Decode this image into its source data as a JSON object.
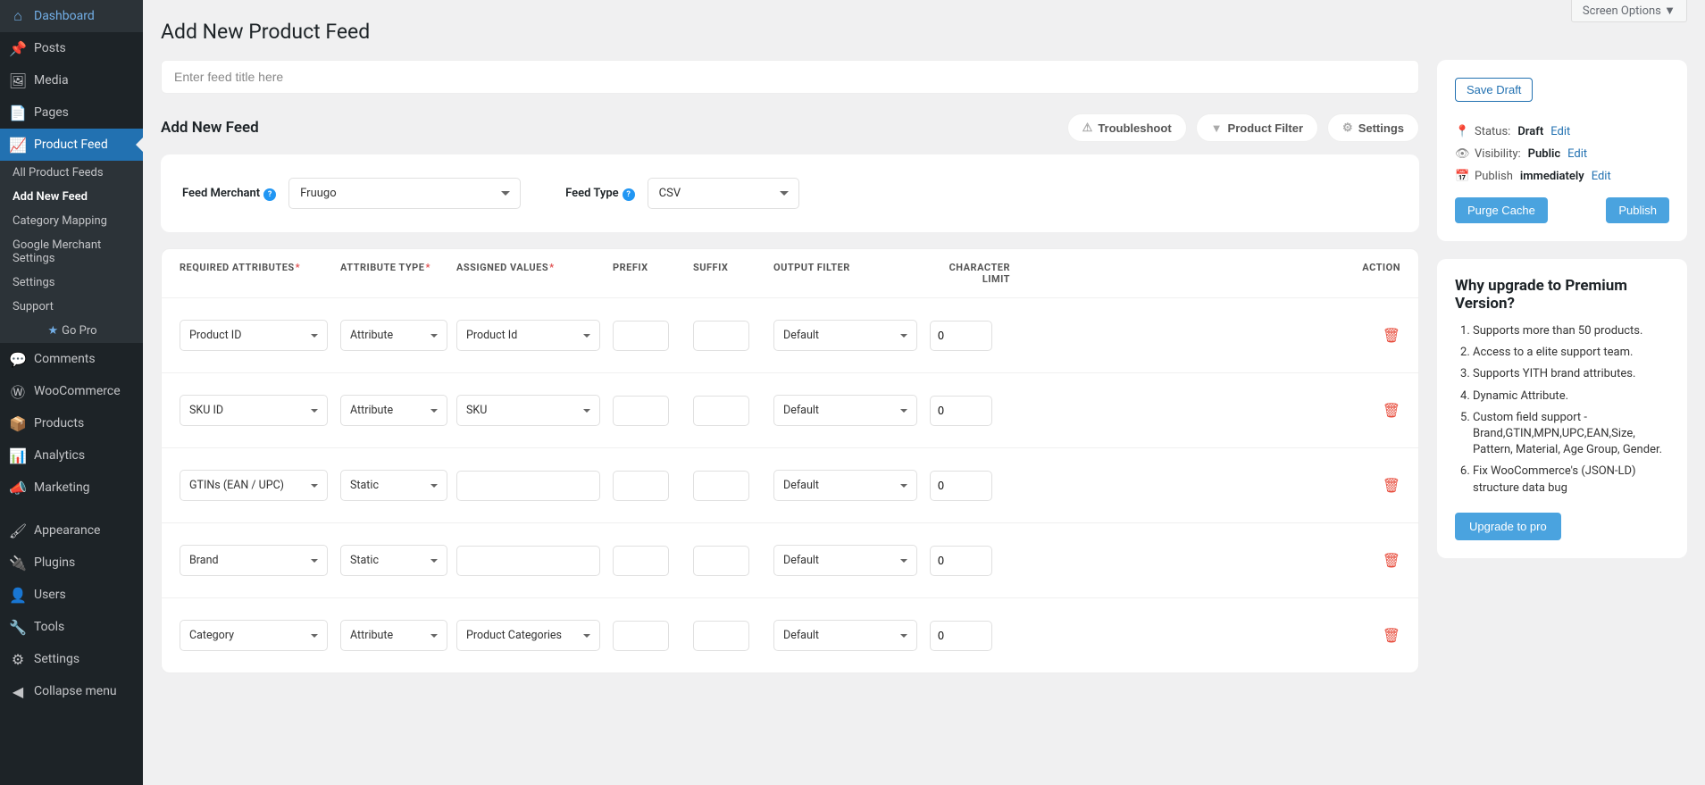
{
  "screen_options": "Screen Options",
  "sidebar": {
    "dashboard": "Dashboard",
    "posts": "Posts",
    "media": "Media",
    "pages": "Pages",
    "product_feed": "Product Feed",
    "sub": {
      "all_feeds": "All Product Feeds",
      "add_new": "Add New Feed",
      "category_mapping": "Category Mapping",
      "google_merchant": "Google Merchant Settings",
      "settings": "Settings",
      "support": "Support",
      "go_pro": "Go Pro"
    },
    "comments": "Comments",
    "woocommerce": "WooCommerce",
    "products": "Products",
    "analytics": "Analytics",
    "marketing": "Marketing",
    "appearance": "Appearance",
    "plugins": "Plugins",
    "users": "Users",
    "tools": "Tools",
    "settings": "Settings",
    "collapse": "Collapse menu"
  },
  "page_title": "Add New Product Feed",
  "title_placeholder": "Enter feed title here",
  "section_title": "Add New Feed",
  "buttons": {
    "troubleshoot": "Troubleshoot",
    "product_filter": "Product Filter",
    "settings": "Settings"
  },
  "merchant": {
    "feed_merchant_label": "Feed Merchant",
    "feed_merchant_value": "Fruugo",
    "feed_type_label": "Feed Type",
    "feed_type_value": "CSV"
  },
  "table": {
    "headers": {
      "required_attributes": "REQUIRED ATTRIBUTES",
      "attribute_type": "ATTRIBUTE TYPE",
      "assigned_values": "ASSIGNED VALUES",
      "prefix": "PREFIX",
      "suffix": "SUFFIX",
      "output_filter": "OUTPUT FILTER",
      "character_limit": "CHARACTER LIMIT",
      "action": "ACTION"
    },
    "rows": [
      {
        "attr": "Product ID",
        "type": "Attribute",
        "assigned": "Product Id",
        "filter": "Default",
        "limit": "0"
      },
      {
        "attr": "SKU ID",
        "type": "Attribute",
        "assigned": "SKU",
        "filter": "Default",
        "limit": "0"
      },
      {
        "attr": "GTINs (EAN / UPC)",
        "type": "Static",
        "assigned": "",
        "filter": "Default",
        "limit": "0"
      },
      {
        "attr": "Brand",
        "type": "Static",
        "assigned": "",
        "filter": "Default",
        "limit": "0"
      },
      {
        "attr": "Category",
        "type": "Attribute",
        "assigned": "Product Categories",
        "filter": "Default",
        "limit": "0"
      }
    ]
  },
  "publish": {
    "save_draft": "Save Draft",
    "status_label": "Status:",
    "status_value": "Draft",
    "visibility_label": "Visibility:",
    "visibility_value": "Public",
    "publish_label": "Publish",
    "publish_value": "immediately",
    "edit": "Edit",
    "purge_cache": "Purge Cache",
    "publish_btn": "Publish"
  },
  "upgrade": {
    "title": "Why upgrade to Premium Version?",
    "items": [
      "Supports more than 50 products.",
      "Access to a elite support team.",
      "Supports YITH brand attributes.",
      "Dynamic Attribute.",
      "Custom field support - Brand,GTIN,MPN,UPC,EAN,Size, Pattern, Material, Age Group, Gender.",
      "Fix WooCommerce's (JSON-LD) structure data bug"
    ],
    "button": "Upgrade to pro"
  }
}
